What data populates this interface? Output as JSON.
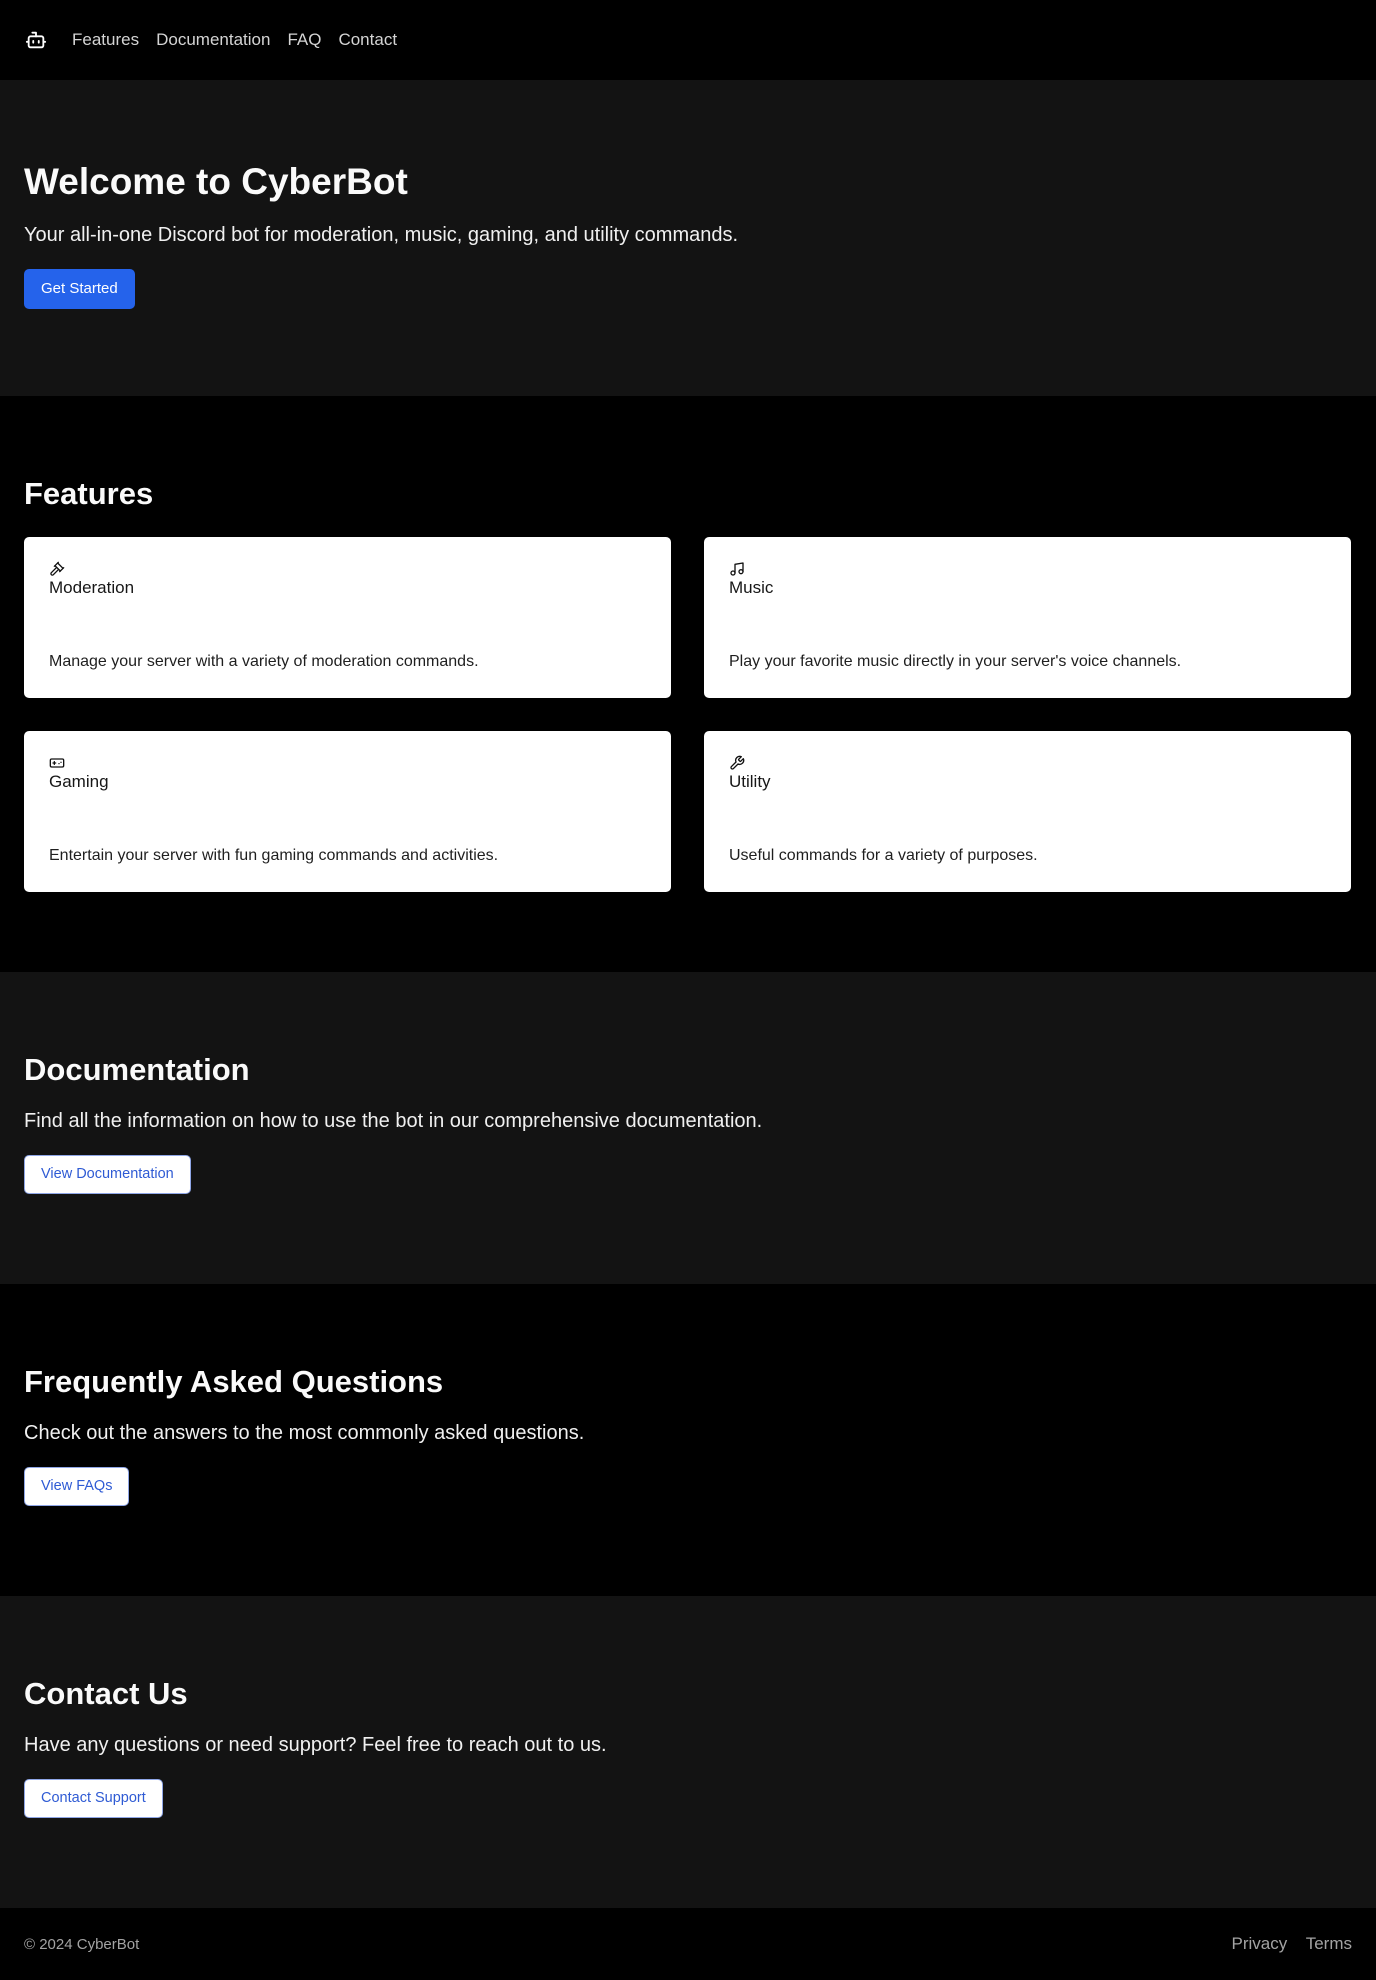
{
  "nav": {
    "logo_icon": "robot-icon",
    "links": [
      "Features",
      "Documentation",
      "FAQ",
      "Contact"
    ]
  },
  "hero": {
    "title": "Welcome to CyberBot",
    "subtitle": "Your all-in-one Discord bot for moderation, music, gaming, and utility commands.",
    "cta": "Get Started"
  },
  "features": {
    "title": "Features",
    "cards": [
      {
        "icon": "gavel-icon",
        "title": "Moderation",
        "desc": "Manage your server with a variety of moderation commands."
      },
      {
        "icon": "music-icon",
        "title": "Music",
        "desc": "Play your favorite music directly in your server's voice channels."
      },
      {
        "icon": "gamepad-icon",
        "title": "Gaming",
        "desc": "Entertain your server with fun gaming commands and activities."
      },
      {
        "icon": "wrench-icon",
        "title": "Utility",
        "desc": "Useful commands for a variety of purposes."
      }
    ]
  },
  "documentation": {
    "title": "Documentation",
    "text": "Find all the information on how to use the bot in our comprehensive documentation.",
    "button": "View Documentation"
  },
  "faq": {
    "title": "Frequently Asked Questions",
    "text": "Check out the answers to the most commonly asked questions.",
    "button": "View FAQs"
  },
  "contact": {
    "title": "Contact Us",
    "text": "Have any questions or need support? Feel free to reach out to us.",
    "button": "Contact Support"
  },
  "footer": {
    "copyright": "© 2024 CyberBot",
    "links": [
      "Privacy",
      "Terms"
    ]
  },
  "colors": {
    "primary": "#2563eb",
    "section_alt_bg": "#131313",
    "page_bg": "#000000"
  }
}
